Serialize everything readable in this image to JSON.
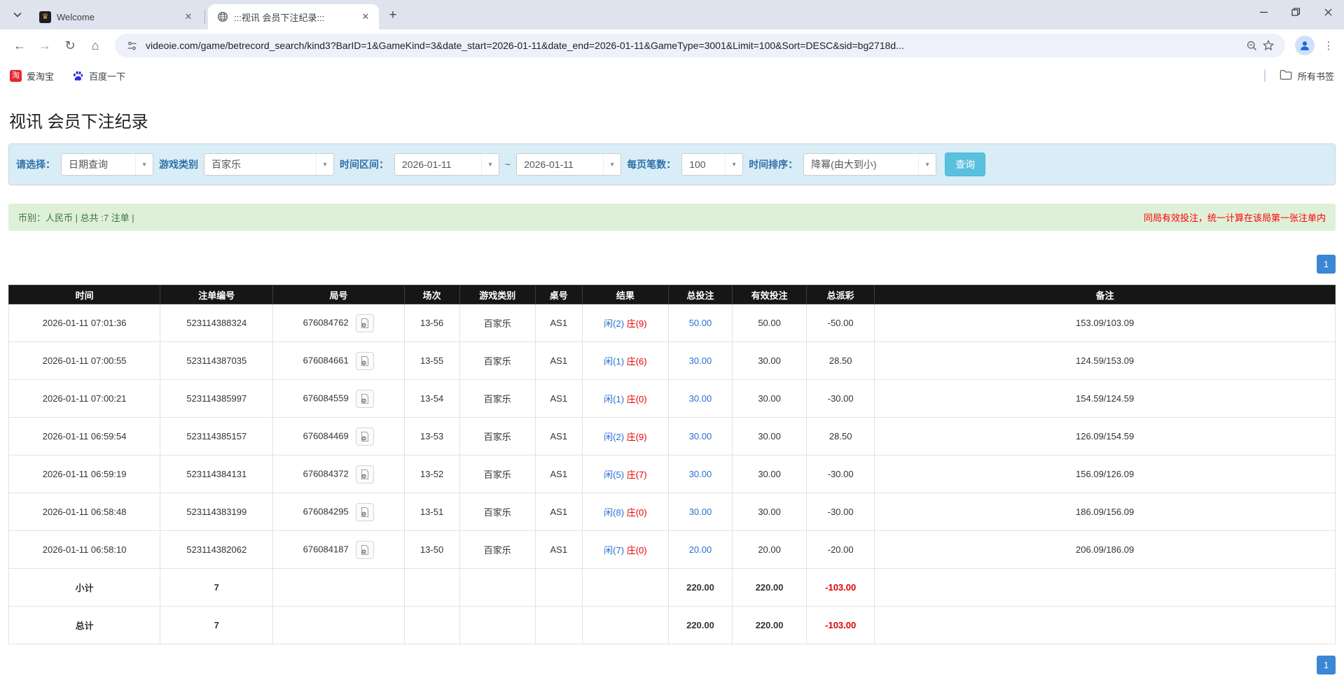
{
  "browser": {
    "tabs": [
      {
        "title": "Welcome",
        "favicon": "welcome-favicon"
      },
      {
        "title": ":::视讯 会员下注纪录:::",
        "favicon": "globe-icon"
      }
    ],
    "url": "videoie.com/game/betrecord_search/kind3?BarID=1&GameKind=3&date_start=2026-01-11&date_end=2026-01-11&GameType=3001&Limit=100&Sort=DESC&sid=bg2718d...",
    "bookmarks": [
      {
        "label": "爱淘宝"
      },
      {
        "label": "百度一下"
      }
    ],
    "bookmarks_right": "所有书签"
  },
  "page": {
    "title": "视讯 会员下注纪录",
    "filters": {
      "select_label": "请选择：",
      "select_value": "日期查询",
      "game_label": "游戏类别",
      "game_value": "百家乐",
      "range_label": "时间区间：",
      "date_start": "2026-01-11",
      "range_tilde": "~",
      "date_end": "2026-01-11",
      "per_page_label": "每页笔数：",
      "per_page_value": "100",
      "sort_label": "时间排序：",
      "sort_value": "降幂(由大到小)",
      "query_button": "查询"
    },
    "info_bar": {
      "left": "币别：人民币 | 总共 :7 注单 |",
      "right": "同局有效投注，统一计算在该局第一张注单内"
    },
    "pagination": {
      "page": "1"
    }
  },
  "table": {
    "columns": [
      {
        "key": "time",
        "label": "时间"
      },
      {
        "key": "bet_id",
        "label": "注单编号"
      },
      {
        "key": "round",
        "label": "局号"
      },
      {
        "key": "session",
        "label": "场次"
      },
      {
        "key": "game",
        "label": "游戏类别"
      },
      {
        "key": "table_no",
        "label": "桌号"
      },
      {
        "key": "result",
        "label": "结果"
      },
      {
        "key": "total_bet",
        "label": "总投注"
      },
      {
        "key": "valid_bet",
        "label": "有效投注"
      },
      {
        "key": "payout",
        "label": "总派彩"
      },
      {
        "key": "remark",
        "label": "备注"
      }
    ],
    "rows": [
      {
        "time": "2026-01-11 07:01:36",
        "bet_id": "523114388324",
        "round": "676084762",
        "session": "13-56",
        "game": "百家乐",
        "table_no": "AS1",
        "result_player": "闲(2)",
        "result_banker": "庄(9)",
        "total_bet": "50.00",
        "valid_bet": "50.00",
        "payout": "-50.00",
        "remark": "153.09/103.09"
      },
      {
        "time": "2026-01-11 07:00:55",
        "bet_id": "523114387035",
        "round": "676084661",
        "session": "13-55",
        "game": "百家乐",
        "table_no": "AS1",
        "result_player": "闲(1)",
        "result_banker": "庄(6)",
        "total_bet": "30.00",
        "valid_bet": "30.00",
        "payout": "28.50",
        "remark": "124.59/153.09"
      },
      {
        "time": "2026-01-11 07:00:21",
        "bet_id": "523114385997",
        "round": "676084559",
        "session": "13-54",
        "game": "百家乐",
        "table_no": "AS1",
        "result_player": "闲(1)",
        "result_banker": "庄(0)",
        "total_bet": "30.00",
        "valid_bet": "30.00",
        "payout": "-30.00",
        "remark": "154.59/124.59"
      },
      {
        "time": "2026-01-11 06:59:54",
        "bet_id": "523114385157",
        "round": "676084469",
        "session": "13-53",
        "game": "百家乐",
        "table_no": "AS1",
        "result_player": "闲(2)",
        "result_banker": "庄(9)",
        "total_bet": "30.00",
        "valid_bet": "30.00",
        "payout": "28.50",
        "remark": "126.09/154.59"
      },
      {
        "time": "2026-01-11 06:59:19",
        "bet_id": "523114384131",
        "round": "676084372",
        "session": "13-52",
        "game": "百家乐",
        "table_no": "AS1",
        "result_player": "闲(5)",
        "result_banker": "庄(7)",
        "total_bet": "30.00",
        "valid_bet": "30.00",
        "payout": "-30.00",
        "remark": "156.09/126.09"
      },
      {
        "time": "2026-01-11 06:58:48",
        "bet_id": "523114383199",
        "round": "676084295",
        "session": "13-51",
        "game": "百家乐",
        "table_no": "AS1",
        "result_player": "闲(8)",
        "result_banker": "庄(0)",
        "total_bet": "30.00",
        "valid_bet": "30.00",
        "payout": "-30.00",
        "remark": "186.09/156.09"
      },
      {
        "time": "2026-01-11 06:58:10",
        "bet_id": "523114382062",
        "round": "676084187",
        "session": "13-50",
        "game": "百家乐",
        "table_no": "AS1",
        "result_player": "闲(7)",
        "result_banker": "庄(0)",
        "total_bet": "20.00",
        "valid_bet": "20.00",
        "payout": "-20.00",
        "remark": "206.09/186.09"
      }
    ],
    "summary_rows": [
      {
        "label": "小计",
        "count": "7",
        "total_bet": "220.00",
        "valid_bet": "220.00",
        "payout": "-103.00"
      },
      {
        "label": "总计",
        "count": "7",
        "total_bet": "220.00",
        "valid_bet": "220.00",
        "payout": "-103.00"
      }
    ]
  }
}
